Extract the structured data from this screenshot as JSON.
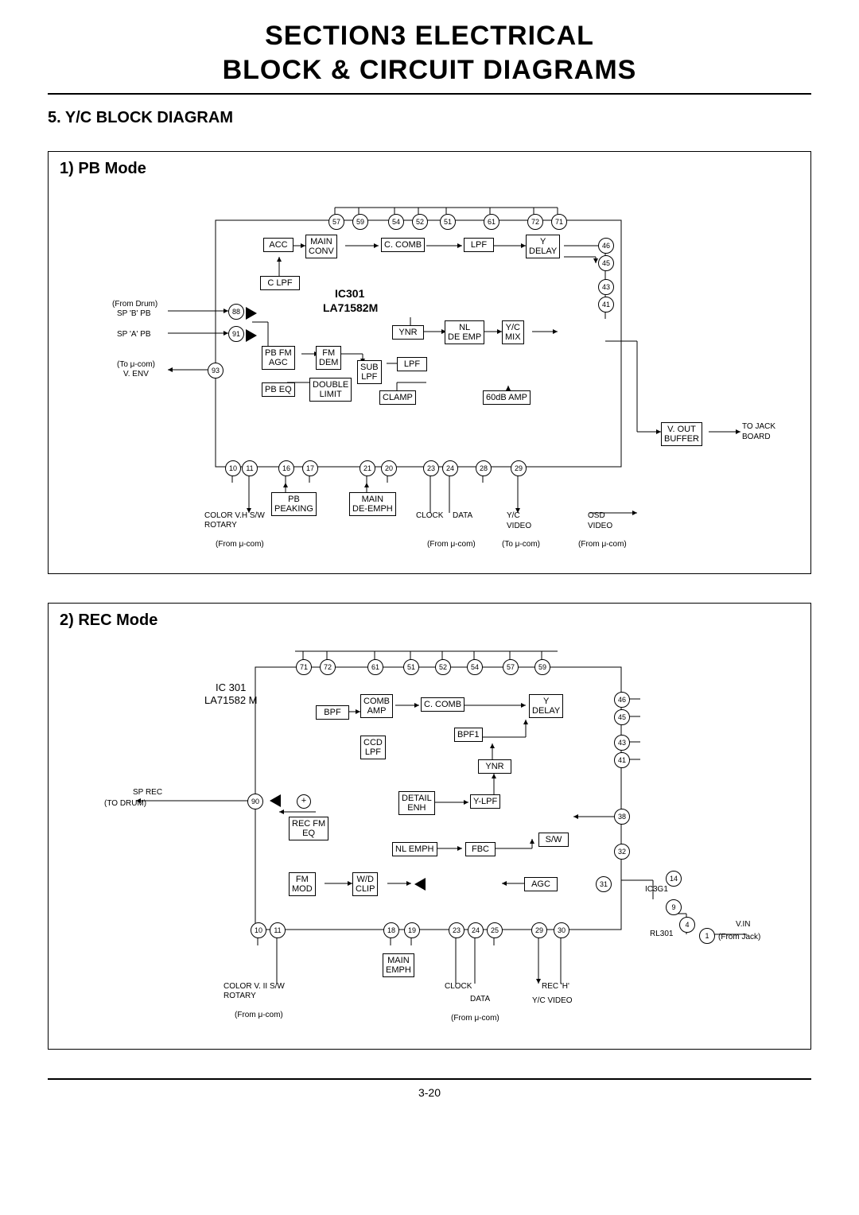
{
  "section_title_line1": "SECTION3   ELECTRICAL",
  "section_title_line2": "BLOCK & CIRCUIT DIAGRAMS",
  "subsection": "5. Y/C BLOCK DIAGRAM",
  "page_number": "3-20",
  "pb": {
    "title": "1) PB Mode",
    "ic_label1": "IC301",
    "ic_label2": "LA71582M",
    "blocks": {
      "acc": "ACC",
      "main_conv": "MAIN\nCONV",
      "c_comb": "C. COMB",
      "lpf": "LPF",
      "y_delay": "Y\nDELAY",
      "c_lpf": "C LPF",
      "ynr": "YNR",
      "nl_deemp": "NL\nDE EMP",
      "yc_mix": "Y/C\nMIX",
      "pb_fm_agc": "PB FM\nAGC",
      "fm_dem": "FM\nDEM",
      "sub_lpf": "SUB\nLPF",
      "lpf2": "LPF",
      "pb_eq": "PB EQ",
      "double_limit": "DOUBLE\nLIMIT",
      "clamp": "CLAMP",
      "sixty_amp": "60dB AMP",
      "pb_peaking": "PB\nPEAKING",
      "main_deemph": "MAIN\nDE-EMPH",
      "vout_buffer": "V. OUT\nBUFFER"
    },
    "pins": [
      "57",
      "59",
      "54",
      "52",
      "51",
      "61",
      "72",
      "71",
      "46",
      "45",
      "43",
      "41",
      "88",
      "91",
      "93",
      "10",
      "11",
      "16",
      "17",
      "21",
      "20",
      "23",
      "24",
      "28",
      "29"
    ],
    "labels": {
      "from_drum": "(From Drum)",
      "sp_b_pb": "SP 'B' PB",
      "sp_a_pb": "SP 'A' PB",
      "to_ucom": "(To μ-com)",
      "v_env": "V. ENV",
      "color_vh": "COLOR   V.H S/W",
      "rotary": "ROTARY",
      "from_ucom": "(From μ-com)",
      "clock": "CLOCK",
      "data": "DATA",
      "yc_video": "Y/C\nVIDEO",
      "to_ucom2": "(To μ-com)",
      "osd_video": "OSD\nVIDEO",
      "from_ucom2": "(From μ-com)",
      "to_jack": "TO JACK\nBOARD"
    }
  },
  "rec": {
    "title": "2) REC Mode",
    "ic_label1": "IC 301",
    "ic_label2": "LA71582 M",
    "blocks": {
      "bpf": "BPF",
      "comb_amp": "COMB\nAMP",
      "c_comb": "C. COMB",
      "y_delay": "Y\nDELAY",
      "bpf1": "BPF1",
      "ccd_lpf": "CCD\nLPF",
      "ynr": "YNR",
      "detail_enh": "DETAIL\nENH",
      "y_lpf": "Y-LPF",
      "rec_fm_eq": "REC FM\nEQ",
      "nl_emph": "NL EMPH",
      "fbc": "FBC",
      "sw": "S/W",
      "fm_mod": "FM\nMOD",
      "wd_clip": "W/D\nCLIP",
      "agc": "AGC",
      "main_emph": "MAIN\nEMPH"
    },
    "pins": [
      "71",
      "72",
      "61",
      "51",
      "52",
      "54",
      "57",
      "59",
      "46",
      "45",
      "43",
      "41",
      "90",
      "38",
      "32",
      "31",
      "14",
      "9",
      "10",
      "11",
      "18",
      "19",
      "23",
      "24",
      "25",
      "29",
      "30",
      "4",
      "1"
    ],
    "labels": {
      "sp_rec": "SP REC",
      "to_drum": "(TO DRUM)",
      "ic3g1": "IC3G1",
      "rl301": "RL301",
      "vin": "V.IN",
      "from_jack": "(From Jack)",
      "color_vii": "COLOR  V. II S/W",
      "rotary": "ROTARY",
      "from_ucom": "(From μ-com)",
      "clock": "CLOCK",
      "data": "DATA",
      "from_ucom2": "(From μ-com)",
      "rec_h": "REC 'H'",
      "yc_video": "Y/C VIDEO"
    }
  }
}
